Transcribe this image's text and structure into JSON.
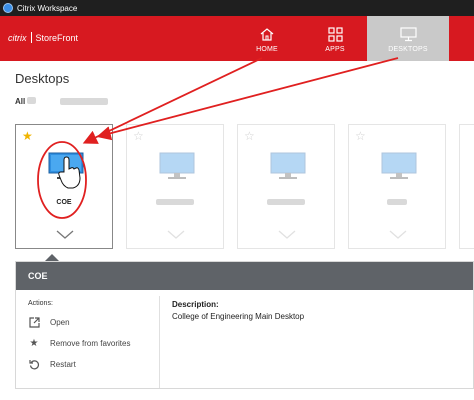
{
  "window": {
    "title": "Citrix Workspace"
  },
  "header": {
    "brand": "citrix",
    "product": "StoreFront",
    "nav": [
      {
        "label": "HOME",
        "icon": "home-icon"
      },
      {
        "label": "APPS",
        "icon": "apps-grid-icon"
      },
      {
        "label": "DESKTOPS",
        "icon": "monitor-icon",
        "active": true
      }
    ]
  },
  "page": {
    "title": "Desktops",
    "filter_all": "All"
  },
  "tiles": [
    {
      "label": "COE",
      "favorite": true,
      "selected": true
    },
    {
      "label": "",
      "favorite": false
    },
    {
      "label": "",
      "favorite": false
    },
    {
      "label": "",
      "favorite": false
    }
  ],
  "details": {
    "name": "COE",
    "actions_title": "Actions:",
    "actions": [
      {
        "label": "Open",
        "icon": "open-external-icon"
      },
      {
        "label": "Remove from favorites",
        "icon": "star-icon"
      },
      {
        "label": "Restart",
        "icon": "restart-icon"
      }
    ],
    "description_title": "Description:",
    "description": "College of Engineering Main Desktop"
  },
  "colors": {
    "header_bg": "#d71920",
    "active_tab_bg": "#c9c9c9",
    "details_head_bg": "#5f6368",
    "favorite_star": "#f0b400",
    "annotation": "#e02020"
  }
}
